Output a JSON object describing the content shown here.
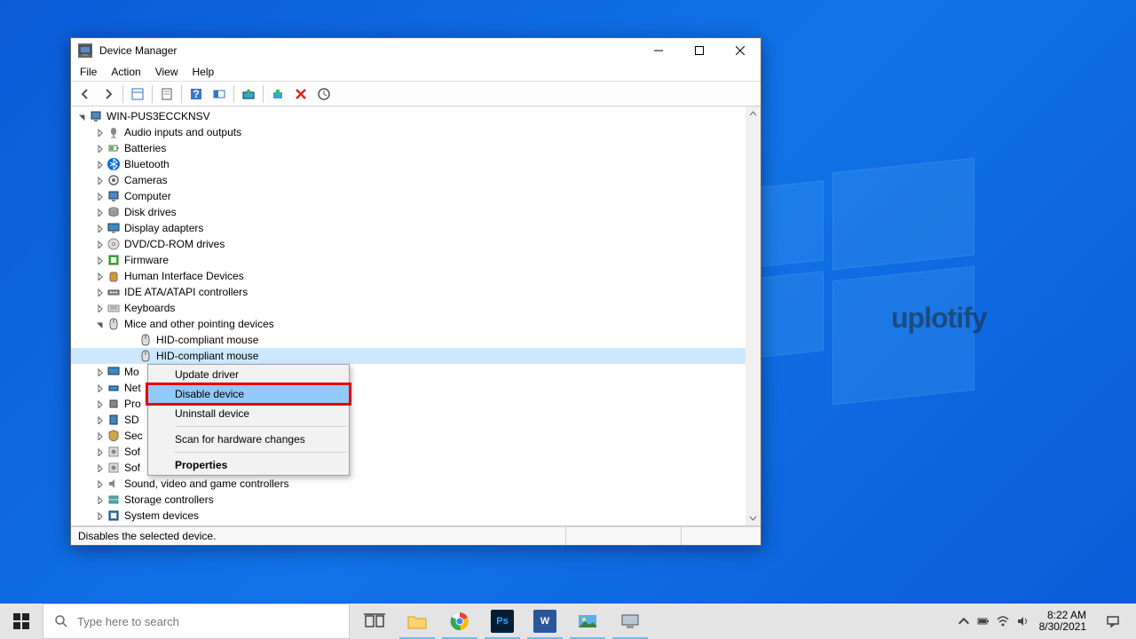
{
  "window": {
    "title": "Device Manager",
    "status": "Disables the selected device."
  },
  "menus": [
    "File",
    "Action",
    "View",
    "Help"
  ],
  "root": "WIN-PUS3ECCKNSV",
  "categories": [
    {
      "label": "Audio inputs and outputs",
      "icon": "audio"
    },
    {
      "label": "Batteries",
      "icon": "battery"
    },
    {
      "label": "Bluetooth",
      "icon": "bt"
    },
    {
      "label": "Cameras",
      "icon": "cam"
    },
    {
      "label": "Computer",
      "icon": "pc"
    },
    {
      "label": "Disk drives",
      "icon": "disk"
    },
    {
      "label": "Display adapters",
      "icon": "disp"
    },
    {
      "label": "DVD/CD-ROM drives",
      "icon": "dvd"
    },
    {
      "label": "Firmware",
      "icon": "fw"
    },
    {
      "label": "Human Interface Devices",
      "icon": "hid"
    },
    {
      "label": "IDE ATA/ATAPI controllers",
      "icon": "ide"
    },
    {
      "label": "Keyboards",
      "icon": "kb"
    }
  ],
  "mice_cat": "Mice and other pointing devices",
  "mice_children": [
    "HID-compliant mouse",
    "HID-compliant mouse"
  ],
  "categories_after": [
    {
      "label": "Mo",
      "icon": "mon"
    },
    {
      "label": "Net",
      "icon": "net"
    },
    {
      "label": "Pro",
      "icon": "cpu"
    },
    {
      "label": "SD",
      "icon": "sd"
    },
    {
      "label": "Sec",
      "icon": "sec"
    },
    {
      "label": "Sof",
      "icon": "soft"
    },
    {
      "label": "Sof",
      "icon": "soft"
    }
  ],
  "categories_end": [
    {
      "label": "Sound, video and game controllers",
      "icon": "snd"
    },
    {
      "label": "Storage controllers",
      "icon": "stor"
    },
    {
      "label": "System devices",
      "icon": "sys"
    }
  ],
  "ctx_items": {
    "update": "Update driver",
    "disable": "Disable device",
    "uninstall": "Uninstall device",
    "scan": "Scan for hardware changes",
    "props": "Properties"
  },
  "search_placeholder": "Type here to search",
  "watermark": "uplotify",
  "clock": {
    "time": "8:22 AM",
    "date": "8/30/2021"
  }
}
